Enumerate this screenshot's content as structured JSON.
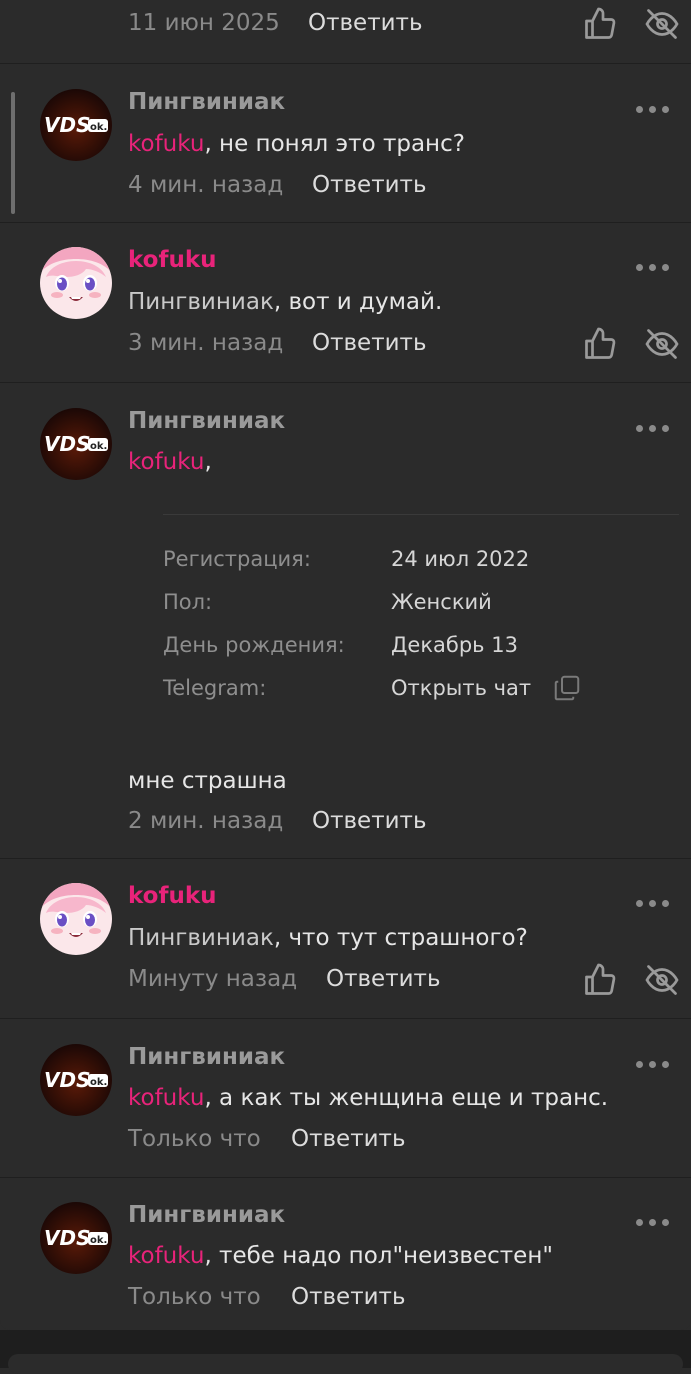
{
  "reply_label": "Ответить",
  "colors": {
    "background": "#2b2b2b",
    "mention": "#e8237a",
    "author": "#9a9a9a",
    "separator": "#1f1f1f"
  },
  "icons": {
    "like": "thumbs-up-icon",
    "hide": "eye-slash-icon",
    "menu": "more-dots-icon",
    "copy": "copy-icon"
  },
  "top_comment": {
    "time": "11 июн 2025"
  },
  "comments": [
    {
      "author": "Пингвиниак",
      "mention": "kofuku",
      "text": ", не понял это транс?",
      "time": "4 мин. назад"
    },
    {
      "author": "kofuku",
      "mention": "Пингвиниак",
      "text": ", вот и думай.",
      "time": "3 мин. назад"
    },
    {
      "author": "Пингвиниак",
      "mention": "kofuku",
      "text": ",",
      "body": "мне страшна",
      "time": "2 мин. назад"
    },
    {
      "author": "kofuku",
      "mention": "Пингвиниак",
      "text": ", что тут страшного?",
      "time": "Минуту назад"
    },
    {
      "author": "Пингвиниак",
      "mention": "kofuku",
      "text": ", а как ты женщина еще и транс.",
      "time": "Только что"
    },
    {
      "author": "Пингвиниак",
      "mention": "kofuku",
      "text": ", тебе надо пол\"неизвестен\"",
      "time": "Только что"
    }
  ],
  "profile_card": {
    "rows": [
      {
        "label": "Регистрация:",
        "value": "24 июл 2022"
      },
      {
        "label": "Пол:",
        "value": "Женский"
      },
      {
        "label": "День рождения:",
        "value": "Декабрь 13"
      },
      {
        "label": "Telegram:",
        "value": "Открыть чат"
      }
    ]
  }
}
